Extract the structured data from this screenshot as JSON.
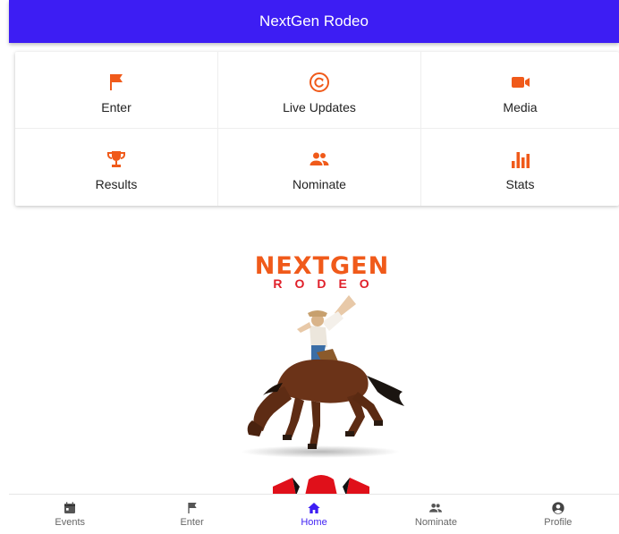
{
  "header": {
    "title": "NextGen Rodeo"
  },
  "colors": {
    "brand": "#3d1df3",
    "accent": "#f05a1a"
  },
  "tiles": [
    {
      "label": "Enter",
      "icon": "flag-icon"
    },
    {
      "label": "Live Updates",
      "icon": "refresh-circle-icon"
    },
    {
      "label": "Media",
      "icon": "video-camera-icon"
    },
    {
      "label": "Results",
      "icon": "trophy-icon"
    },
    {
      "label": "Nominate",
      "icon": "people-icon"
    },
    {
      "label": "Stats",
      "icon": "bar-chart-icon"
    }
  ],
  "logo": {
    "title": "NEXTGEN",
    "subtitle": "RODEO"
  },
  "nav": [
    {
      "label": "Events",
      "icon": "calendar-icon"
    },
    {
      "label": "Enter",
      "icon": "flag-icon"
    },
    {
      "label": "Home",
      "icon": "home-icon",
      "active": true
    },
    {
      "label": "Nominate",
      "icon": "people-icon"
    },
    {
      "label": "Profile",
      "icon": "account-circle-icon"
    }
  ]
}
